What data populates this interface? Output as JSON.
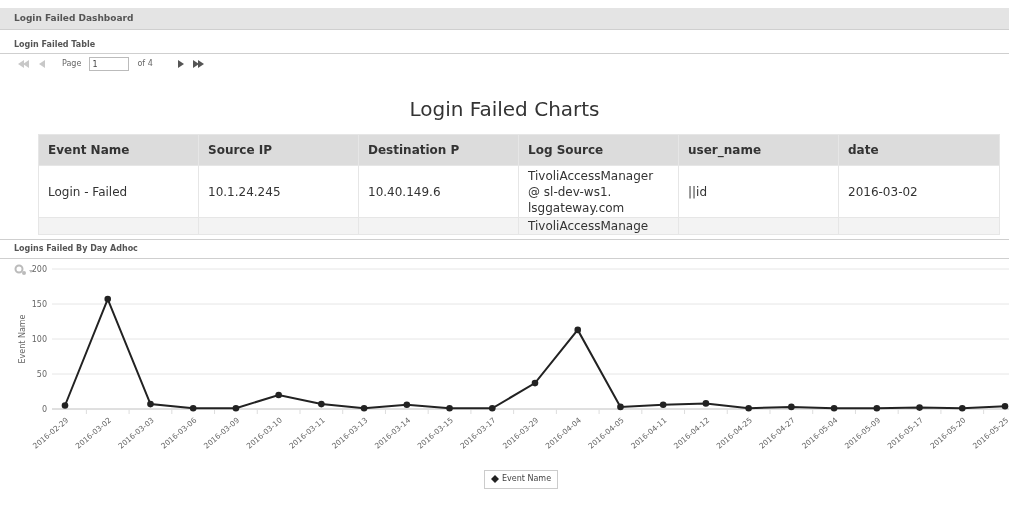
{
  "dashboard": {
    "title": "Login Failed Dashboard"
  },
  "table_panel": {
    "title": "Login Failed Table",
    "pager": {
      "page_label": "Page",
      "page": "1",
      "of_label": "of 4",
      "first_disabled": true,
      "prev_disabled": true,
      "next_disabled": false,
      "last_disabled": false
    },
    "heading": "Login Failed Charts",
    "columns": [
      "Event Name",
      "Source IP",
      "Destination P",
      "Log Source",
      "user_name",
      "date"
    ],
    "rows": [
      {
        "cells": [
          "Login - Failed",
          "10.1.24.245",
          "10.40.149.6",
          "TivoliAccessManager @ sl-dev-ws1. lsggateway.com",
          "||id",
          "2016-03-02"
        ]
      },
      {
        "cells": [
          null,
          null,
          null,
          "TivoliAccessManage",
          null,
          null
        ]
      }
    ]
  },
  "chart_panel": {
    "title": "Logins Failed By Day Adhoc",
    "chart_data": {
      "type": "line",
      "grid": true,
      "ylabel": "Event Name",
      "ylim": [
        0,
        200
      ],
      "yticks": [
        0,
        50,
        100,
        150,
        200
      ],
      "categories": [
        "2016-02-29",
        "2016-03-02",
        "2016-03-03",
        "2016-03-06",
        "2016-03-09",
        "2016-03-10",
        "2016-03-11",
        "2016-03-13",
        "2016-03-14",
        "2016-03-15",
        "2016-03-17",
        "2016-03-29",
        "2016-04-04",
        "2016-04-05",
        "2016-04-11",
        "2016-04-12",
        "2016-04-25",
        "2016-04-27",
        "2016-05-04",
        "2016-05-09",
        "2016-05-17",
        "2016-05-20",
        "2016-05-25"
      ],
      "series": [
        {
          "name": "Event Name",
          "color": "#222222",
          "marker": "circle",
          "values": [
            5,
            157,
            7,
            1,
            1,
            20,
            7,
            1,
            6,
            1,
            1,
            37,
            113,
            3,
            6,
            8,
            1,
            3,
            1,
            1,
            2,
            1,
            4
          ]
        }
      ]
    }
  }
}
